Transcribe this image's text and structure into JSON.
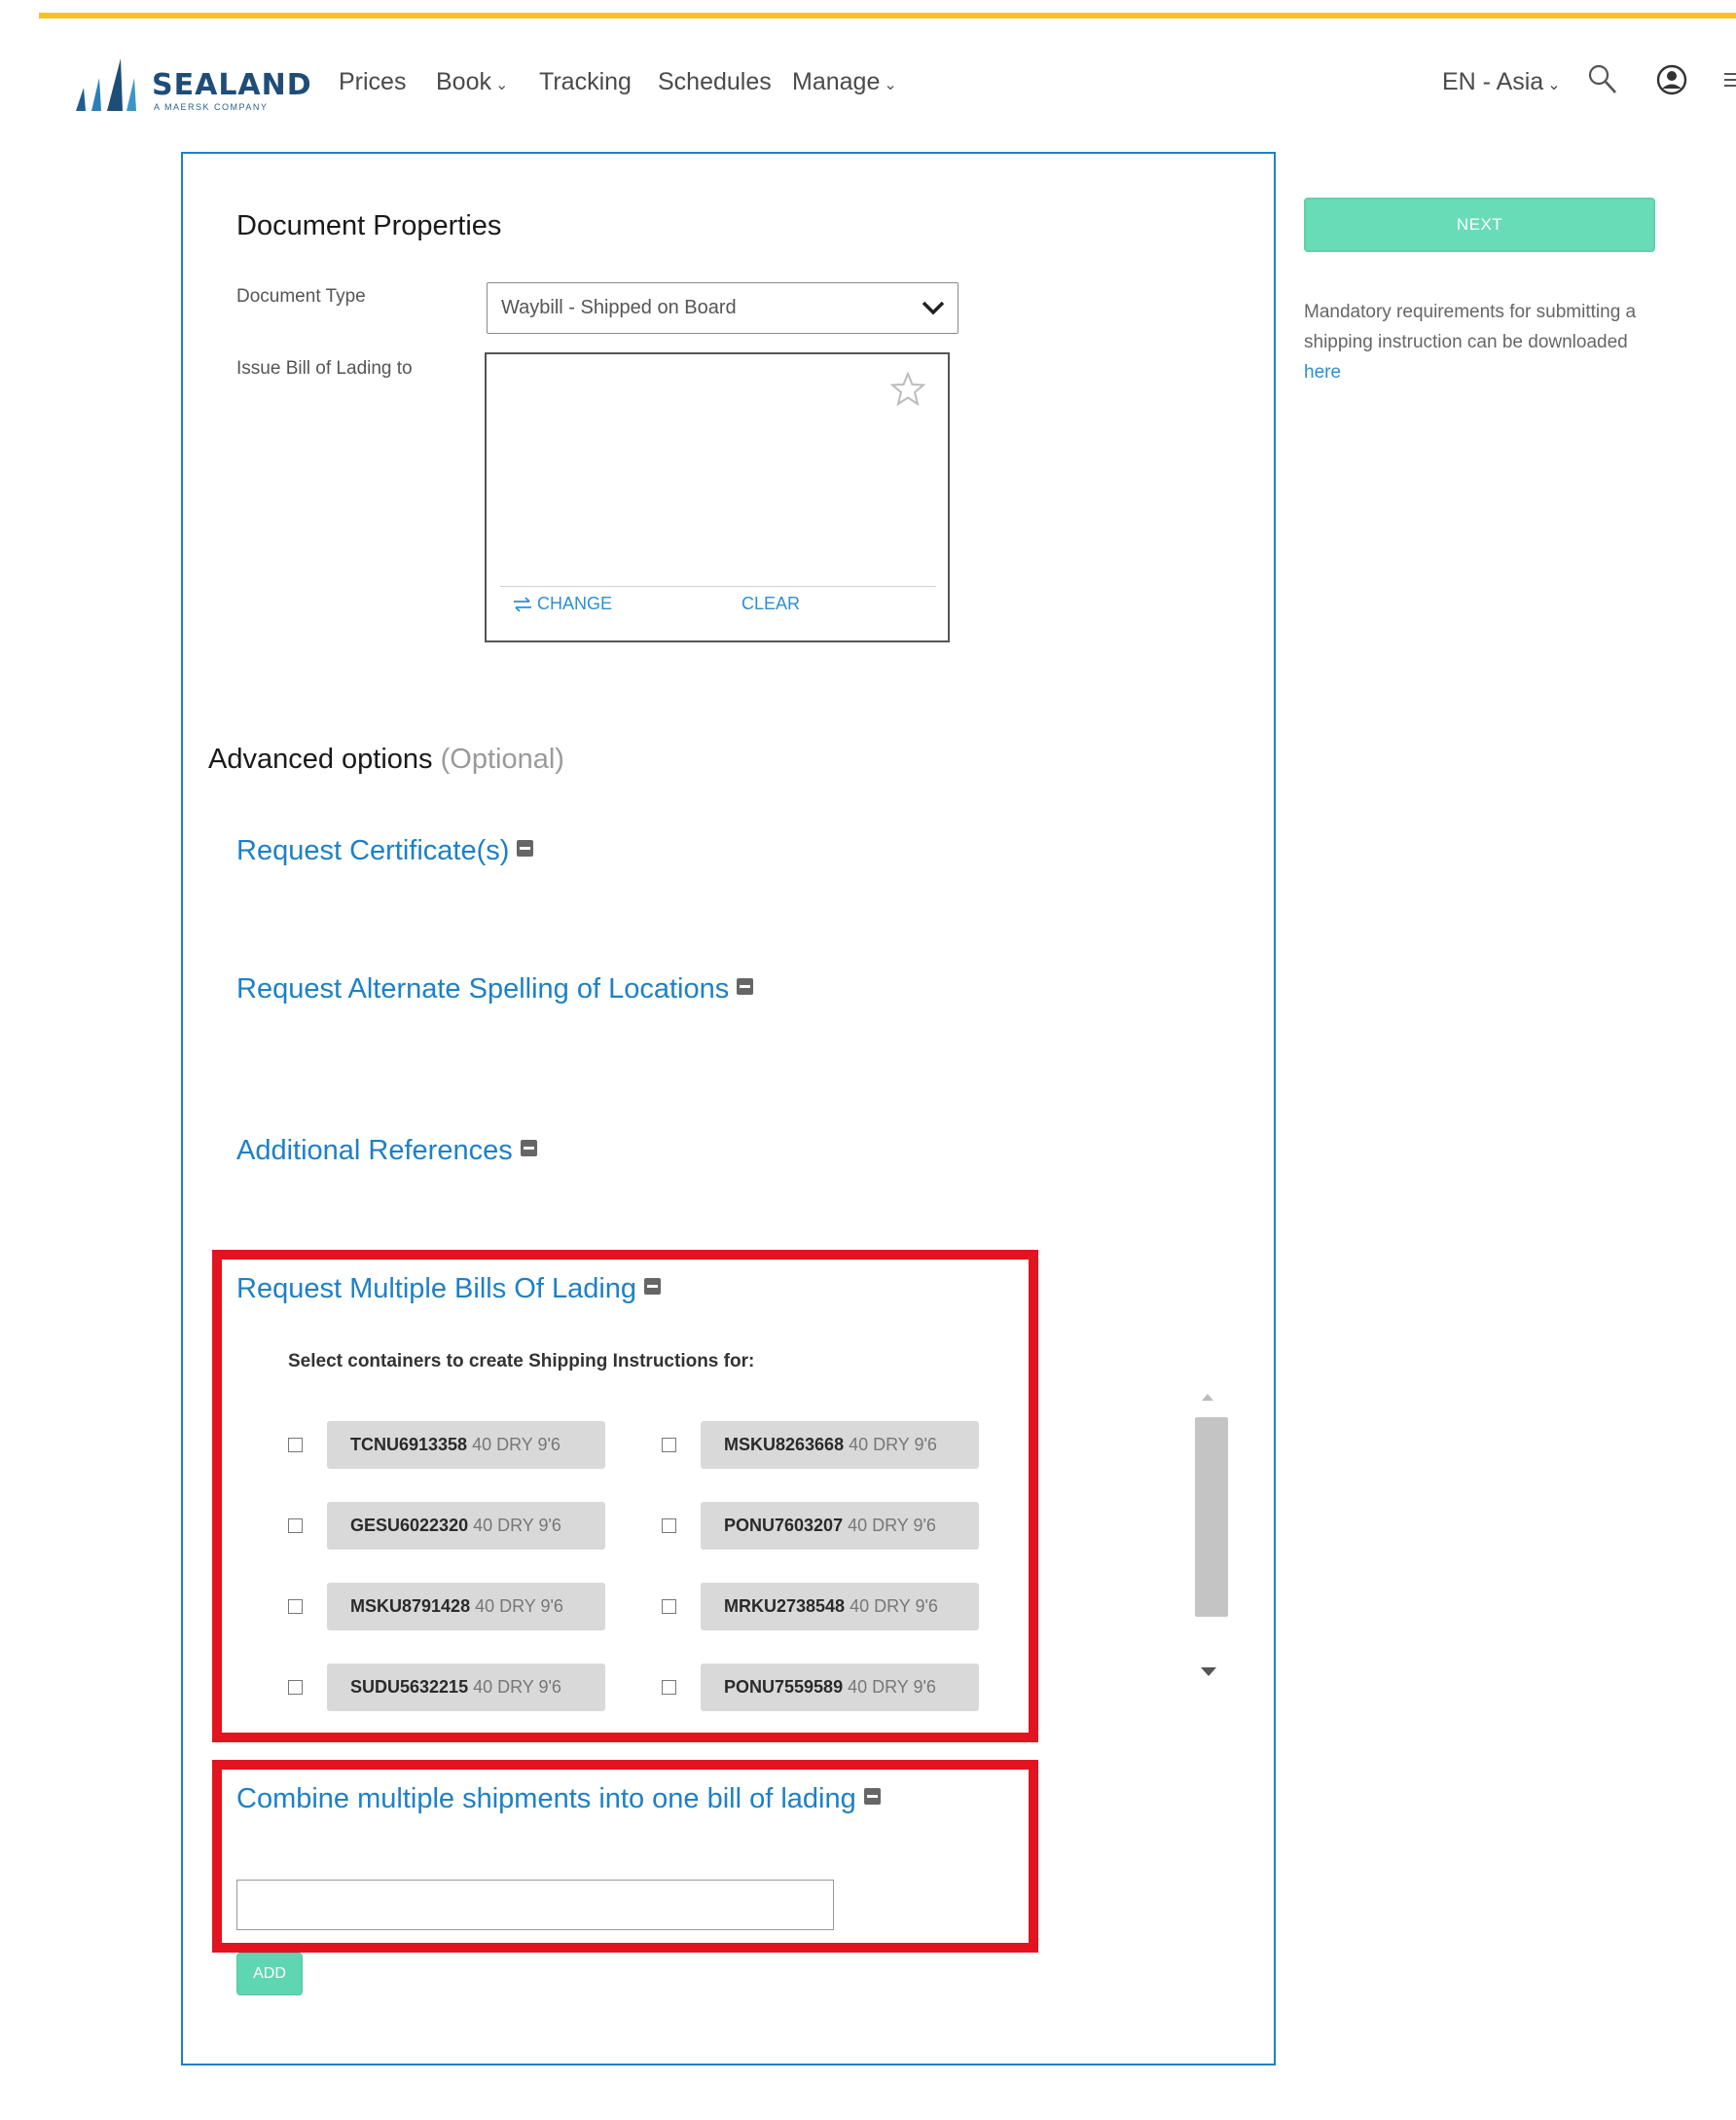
{
  "header": {
    "logo_text": "SEALAND",
    "logo_sub": "A MAERSK COMPANY",
    "nav": [
      {
        "label": "Prices"
      },
      {
        "label": "Book",
        "chevron": "⌄"
      },
      {
        "label": "Tracking"
      },
      {
        "label": "Schedules"
      },
      {
        "label": "Manage",
        "chevron": "⌄"
      }
    ],
    "lang": "EN - Asia",
    "lang_chevron": "⌄",
    "icons": [
      "search-icon",
      "user-icon",
      "menu-icon"
    ]
  },
  "document_properties": {
    "title": "Document Properties",
    "document_type_label": "Document Type",
    "document_type_value": "Waybill - Shipped on Board",
    "issue_label": "Issue Bill of Lading to",
    "change_label": "CHANGE",
    "clear_label": "CLEAR"
  },
  "advanced": {
    "title": "Advanced options",
    "optional": "(Optional)",
    "sections": {
      "certificates": "Request Certificate(s)",
      "alt_spelling": "Request Alternate Spelling of Locations",
      "additional_refs": "Additional References",
      "multiple_bl": "Request Multiple Bills Of Lading",
      "combine": "Combine multiple shipments into one bill of lading"
    },
    "select_containers_label": "Select containers to create Shipping Instructions for:",
    "containers": [
      {
        "number": "TCNU6913358",
        "size": "40 DRY 9'6"
      },
      {
        "number": "MSKU8263668",
        "size": "40 DRY 9'6"
      },
      {
        "number": "GESU6022320",
        "size": "40 DRY 9'6"
      },
      {
        "number": "PONU7603207",
        "size": "40 DRY 9'6"
      },
      {
        "number": "MSKU8791428",
        "size": "40 DRY 9'6"
      },
      {
        "number": "MRKU2738548",
        "size": "40 DRY 9'6"
      },
      {
        "number": "SUDU5632215",
        "size": "40 DRY 9'6"
      },
      {
        "number": "PONU7559589",
        "size": "40 DRY 9'6"
      }
    ],
    "combine_input_value": "",
    "add_label": "ADD"
  },
  "sidebar": {
    "next_label": "NEXT",
    "info_text": "Mandatory requirements for submitting a shipping instruction can be downloaded",
    "info_link": "here"
  },
  "colors": {
    "accent": "#1d80c7",
    "button": "#68dcb6",
    "highlight": "#e2141f",
    "topbar": "#f2c22a"
  }
}
